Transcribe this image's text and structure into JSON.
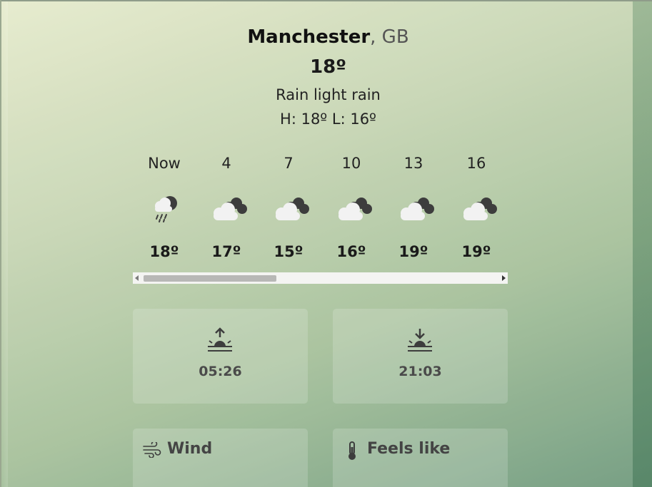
{
  "location": {
    "city": "Manchester",
    "country": ", GB"
  },
  "current": {
    "temperature": "18º",
    "description": "Rain light rain",
    "high_low": "H: 18º L: 16º"
  },
  "hourly": [
    {
      "label": "Now",
      "temp": "18º",
      "icon": "rain-cloud-icon"
    },
    {
      "label": "4",
      "temp": "17º",
      "icon": "broken-clouds-icon"
    },
    {
      "label": "7",
      "temp": "15º",
      "icon": "broken-clouds-icon"
    },
    {
      "label": "10",
      "temp": "16º",
      "icon": "broken-clouds-icon"
    },
    {
      "label": "13",
      "temp": "19º",
      "icon": "broken-clouds-icon"
    },
    {
      "label": "16",
      "temp": "19º",
      "icon": "broken-clouds-icon"
    }
  ],
  "sun": {
    "sunrise": "05:26",
    "sunset": "21:03"
  },
  "details": {
    "wind_label": "Wind",
    "feels_like_label": "Feels like"
  },
  "colors": {
    "tile_text": "#4a4a4a",
    "icon_dark": "#3d3d3d",
    "cloud_light": "#f2f2f2"
  }
}
